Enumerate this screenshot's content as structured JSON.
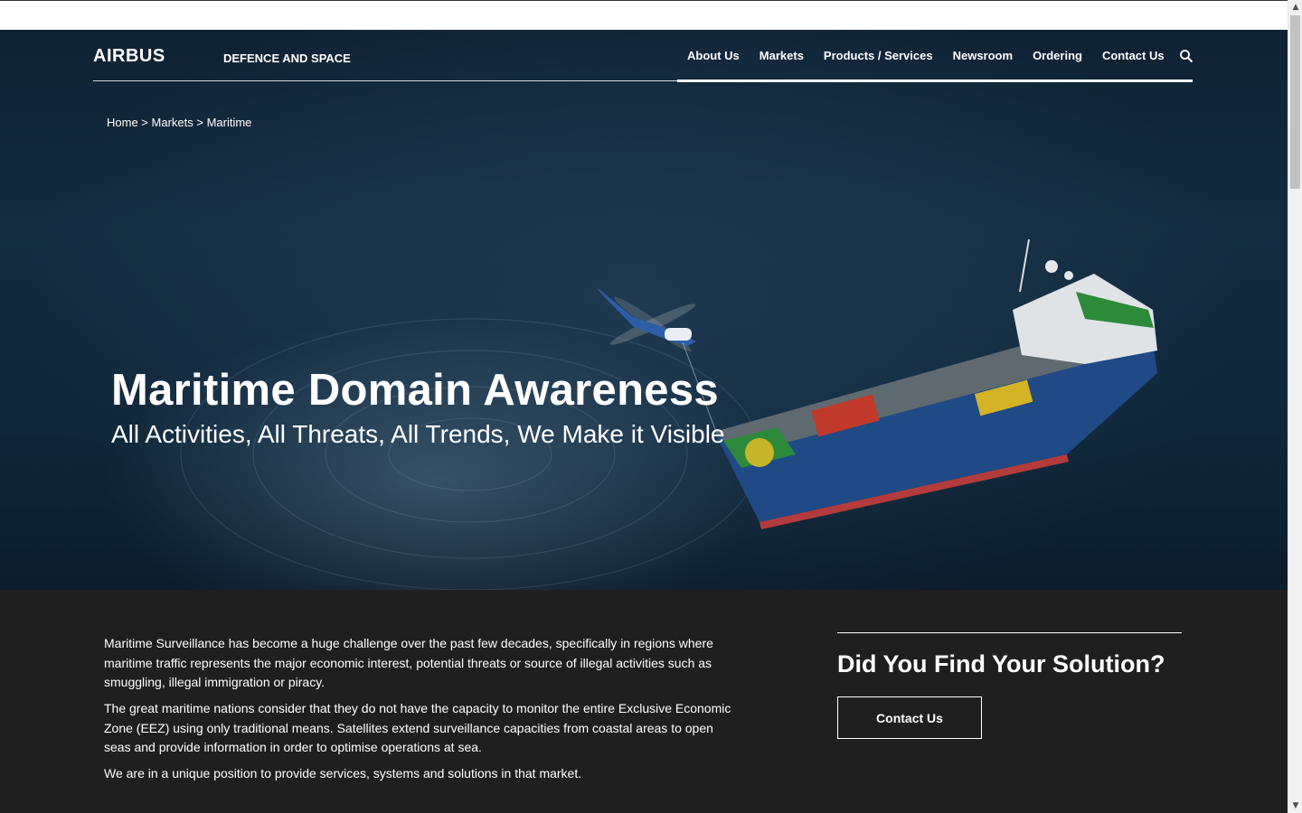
{
  "header": {
    "logo": "AIRBUS",
    "division": "DEFENCE AND SPACE",
    "nav": [
      "About Us",
      "Markets",
      "Products / Services",
      "Newsroom",
      "Ordering",
      "Contact Us"
    ]
  },
  "breadcrumb": {
    "home": "Home",
    "sep1": " > ",
    "markets": "Markets",
    "sep2": " > ",
    "current": "Maritime"
  },
  "hero": {
    "title": "Maritime Domain Awareness",
    "subtitle": "All Activities, All Threats, All Trends, We Make it Visible"
  },
  "content": {
    "paragraphs": [
      "Maritime Surveillance has become a huge challenge over the past few decades, specifically in regions where maritime traffic represents the major economic interest, potential threats or source of illegal activities such as smuggling, illegal immigration or piracy.",
      "The great maritime nations consider that they do not have the capacity to monitor the entire Exclusive Economic Zone (EEZ) using only traditional means. Satellites extend surveillance capacities from coastal areas to open seas and provide information in order to optimise operations at sea.",
      "We are in a unique position to provide services, systems and solutions in that market."
    ]
  },
  "cta": {
    "heading": "Did You Find Your Solution?",
    "button": "Contact Us"
  },
  "colors": {
    "sea": "#132c40",
    "content_bg": "#1f1f1f",
    "text": "#ffffff"
  },
  "icons": {
    "search": "search-icon",
    "scroll_up": "chevron-up-icon",
    "scroll_down": "chevron-down-icon"
  }
}
